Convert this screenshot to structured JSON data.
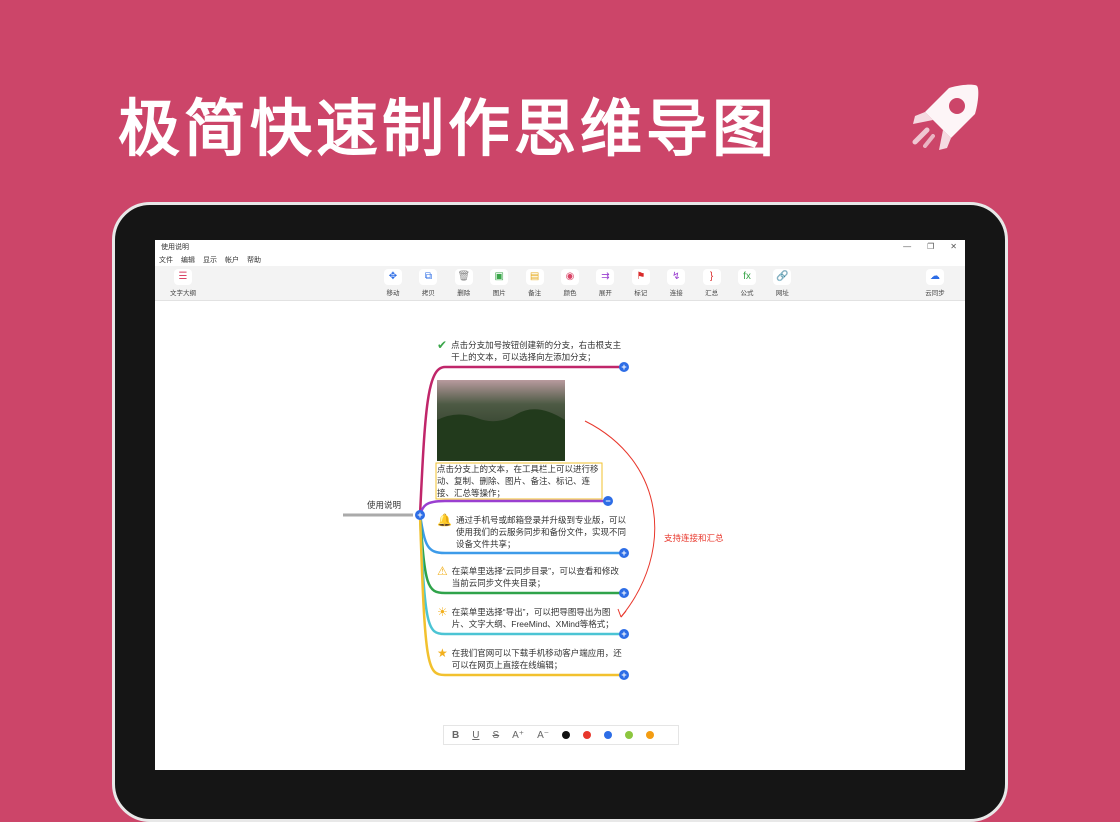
{
  "headline": "极简快速制作思维导图",
  "window": {
    "title": "使用说明",
    "controls": [
      "—",
      "❐",
      "✕"
    ]
  },
  "menu": [
    "文件",
    "编辑",
    "显示",
    "帐户",
    "帮助"
  ],
  "toolbar": {
    "outline": "文字大纲",
    "items": [
      {
        "label": "移动",
        "icon": "move-icon",
        "glyph": "✥",
        "color": "#2d6de6"
      },
      {
        "label": "拷贝",
        "icon": "copy-icon",
        "glyph": "⧉",
        "color": "#2d6de6"
      },
      {
        "label": "删除",
        "icon": "trash-icon",
        "glyph": "🗑",
        "color": "#888888"
      },
      {
        "label": "图片",
        "icon": "image-icon",
        "glyph": "▣",
        "color": "#3aa64a"
      },
      {
        "label": "备注",
        "icon": "note-icon",
        "glyph": "▤",
        "color": "#e6a817"
      },
      {
        "label": "颜色",
        "icon": "palette-icon",
        "glyph": "◉",
        "color": "#d94466"
      },
      {
        "label": "展开",
        "icon": "expand-icon",
        "glyph": "⇉",
        "color": "#9a3fd0"
      },
      {
        "label": "标记",
        "icon": "flag-icon",
        "glyph": "⚑",
        "color": "#d92b2b"
      },
      {
        "label": "连接",
        "icon": "link-line-icon",
        "glyph": "↯",
        "color": "#9a3fd0"
      },
      {
        "label": "汇总",
        "icon": "summary-brace-icon",
        "glyph": "}",
        "color": "#d92b2b"
      },
      {
        "label": "公式",
        "icon": "formula-icon",
        "glyph": "fx",
        "color": "#3aa64a"
      },
      {
        "label": "网址",
        "icon": "url-link-icon",
        "glyph": "🔗",
        "color": "#3aa64a"
      }
    ],
    "sync": "云同步"
  },
  "mindmap": {
    "root": "使用说明",
    "branches": [
      {
        "text": "点击分支加号按钮创建新的分支，右击根支主干上的文本，可以选择向左添加分支；",
        "icon": "check-circle-icon",
        "color": "#c0266a"
      },
      {
        "text": "点击分支上的文本，在工具栏上可以进行移动、复制、删除、图片、备注、标记、连接、汇总等操作；",
        "icon": "photo-thumbnail",
        "color": "#9a3fd0"
      },
      {
        "text": "通过手机号或邮箱登录并升级到专业版，可以使用我们的云服务同步和备份文件，实现不同设备文件共享；",
        "icon": "bell-icon",
        "color": "#3d9be9"
      },
      {
        "text": "在菜单里选择“云同步目录”，可以查看和修改当前云同步文件夹目录；",
        "icon": "warning-icon",
        "color": "#2fa34a"
      },
      {
        "text": "在菜单里选择“导出”，可以把导图导出为图片、文字大纲、FreeMind、XMind等格式；",
        "icon": "lightbulb-icon",
        "color": "#4bc4d4"
      },
      {
        "text": "在我们官网可以下载手机移动客户端应用，还可以在网页上直接在线编辑；",
        "icon": "star-icon",
        "color": "#f2c12e"
      }
    ],
    "connection_label": "支持连接和汇总"
  },
  "format_bar": {
    "buttons": [
      "B",
      "U",
      "S",
      "A⁺",
      "A⁻"
    ],
    "colors": [
      "#111111",
      "#e8372c",
      "#2d6de6",
      "#8cc63f",
      "#f39c12"
    ]
  }
}
